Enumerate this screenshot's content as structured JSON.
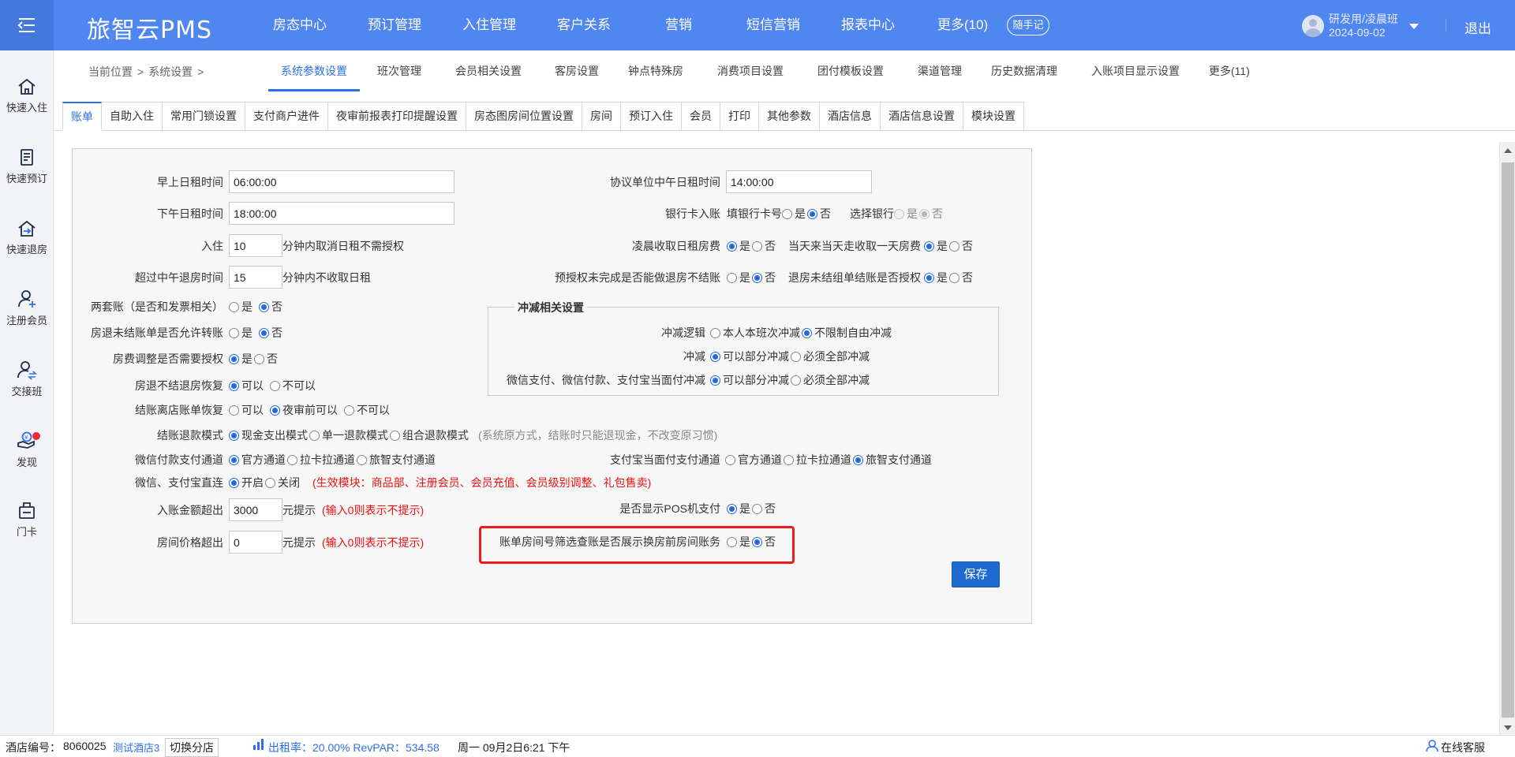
{
  "app": {
    "logo": "旅智云PMS"
  },
  "topnav": [
    "房态中心",
    "预订管理",
    "入住管理",
    "客户关系",
    "营销",
    "短信营销",
    "报表中心",
    "更多(10)"
  ],
  "topbar": {
    "memo": "随手记",
    "user_name": "研发用/凌晨班",
    "user_date": "2024-09-02",
    "logout": "退出"
  },
  "sidebar": [
    {
      "label": "快速入住",
      "icon": "home-icon"
    },
    {
      "label": "快速预订",
      "icon": "document-icon"
    },
    {
      "label": "快速退房",
      "icon": "checkout-icon"
    },
    {
      "label": "注册会员",
      "icon": "add-user-icon"
    },
    {
      "label": "交接班",
      "icon": "handover-icon"
    },
    {
      "label": "发现",
      "icon": "discover-icon"
    },
    {
      "label": "门卡",
      "icon": "card-icon"
    }
  ],
  "breadcrumb": {
    "current_label": "当前位置",
    "sep": ">",
    "section": "系统设置",
    "sep2": ">"
  },
  "subnav": [
    "系统参数设置",
    "班次管理",
    "会员相关设置",
    "客房设置",
    "钟点特殊房",
    "消费项目设置",
    "团付模板设置",
    "渠道管理",
    "历史数据清理",
    "入账项目显示设置",
    "更多(11)"
  ],
  "tabs": [
    "账单",
    "自助入住",
    "常用门锁设置",
    "支付商户进件",
    "夜审前报表打印提醒设置",
    "房态图房间位置设置",
    "房间",
    "预订入住",
    "会员",
    "打印",
    "其他参数",
    "酒店信息",
    "酒店信息设置",
    "模块设置"
  ],
  "form": {
    "morning_rent_label": "早上日租时间",
    "morning_rent_value": "06:00:00",
    "afternoon_rent_label": "下午日租时间",
    "afternoon_rent_value": "18:00:00",
    "checkin_label": "入住",
    "checkin_value": "10",
    "checkin_suffix": "分钟内取消日租不需授权",
    "noon_checkout_label": "超过中午退房时间",
    "noon_checkout_value": "15",
    "noon_checkout_suffix": "分钟内不收取日租",
    "double_account_label": "两套账（是否和发票相关）",
    "unsettled_transfer_label": "房退未结账单是否允许转账",
    "fee_adjust_label": "房费调整是否需要授权",
    "unsettled_restore_label": "房退不结退房恢复",
    "opt_can": "可以",
    "opt_cannot": "不可以",
    "settle_restore_label": "结账离店账单恢复",
    "opt_before_audit": "夜审前可以",
    "refund_mode_label": "结账退款模式",
    "refund_opt1": "现金支出模式",
    "refund_opt2": "单一退款模式",
    "refund_opt3": "组合退款模式",
    "refund_note": "(系统原方式，结账时只能退现金，不改变原习惯)",
    "wechat_channel_label": "微信付款支付通道",
    "ch_official": "官方通道",
    "ch_lakala": "拉卡拉通道",
    "ch_lvzhi": "旅智支付通道",
    "direct_label": "微信、支付宝直连",
    "opt_on": "开启",
    "opt_off": "关闭",
    "direct_note": "(生效模块：商品部、注册会员、会员充值、会员级别调整、礼包售卖)",
    "amount_exceed_label": "入账金额超出",
    "amount_exceed_value": "3000",
    "suffix_tip": "元提示",
    "zero_note": "(输入0则表示不提示)",
    "price_exceed_label": "房间价格超出",
    "price_exceed_value": "0",
    "agreement_noon_label": "协议单位中午日租时间",
    "agreement_noon_value": "14:00:00",
    "bankcard_label": "银行卡入账",
    "bankcard_fill": "填银行卡号",
    "bankcard_select": "选择银行",
    "yes": "是",
    "no": "否",
    "early_morning_label": "凌晨收取日租房费",
    "same_day_label": "当天来当天走收取一天房费",
    "preauth_label": "预授权未完成是否能做退房不结账",
    "group_unsettled_label": "退房未结组单结账是否授权",
    "offset_legend": "冲减相关设置",
    "offset_logic_label": "冲减逻辑",
    "offset_logic_opt1": "本人本班次冲减",
    "offset_logic_opt2": "不限制自由冲减",
    "offset_label": "冲减",
    "offset_opt1": "可以部分冲减",
    "offset_opt2": "必须全部冲减",
    "offset_pay_label": "微信支付、微信付款、支付宝当面付冲减",
    "alipay_channel_label": "支付宝当面付支付通道",
    "pos_label": "是否显示POS机支付",
    "room_filter_label": "账单房间号筛选查账是否展示换房前房间账务",
    "save": "保存"
  },
  "status": {
    "hotel_no_label": "酒店编号：",
    "hotel_no": "8060025",
    "hotel_name": "测试酒店3",
    "switch": "切换分店",
    "occupancy": "出租率：20.00% RevPAR：534.58",
    "datetime": "周一 09月2日6:21 下午",
    "service": "在线客服"
  },
  "colors": {
    "primary": "#4f86ef",
    "active_tab": "#2d6fe8",
    "highlight": "#ee1c1c",
    "save": "#1f6ad0"
  }
}
